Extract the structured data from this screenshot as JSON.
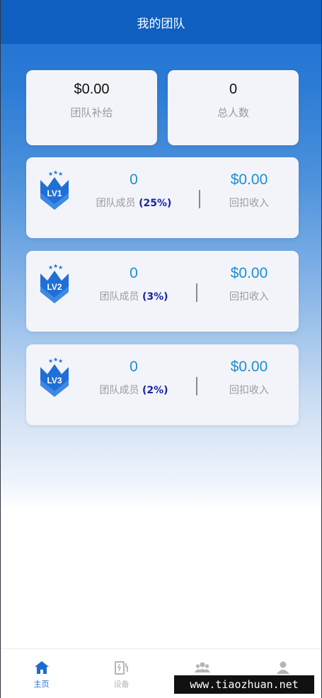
{
  "header": {
    "title": "我的团队"
  },
  "stats": [
    {
      "value": "$0.00",
      "label": "团队补给"
    },
    {
      "value": "0",
      "label": "总人数"
    }
  ],
  "levels": [
    {
      "badge": "LV1",
      "members": "0",
      "members_label": "团队成员",
      "percent": "(25%)",
      "income": "$0.00",
      "income_label": "回扣收入"
    },
    {
      "badge": "LV2",
      "members": "0",
      "members_label": "团队成员",
      "percent": "(3%)",
      "income": "$0.00",
      "income_label": "回扣收入"
    },
    {
      "badge": "LV3",
      "members": "0",
      "members_label": "团队成员",
      "percent": "(2%)",
      "income": "$0.00",
      "income_label": "回扣收入"
    }
  ],
  "tabbar": {
    "items": [
      {
        "label": "主页",
        "icon": "home-icon",
        "active": true
      },
      {
        "label": "设备",
        "icon": "device-icon",
        "active": false
      },
      {
        "label": "",
        "icon": "team-icon",
        "active": false
      },
      {
        "label": "",
        "icon": "user-icon",
        "active": false
      }
    ]
  },
  "watermark": "www.tiaozhuan.net",
  "colors": {
    "header": "#0f5fc0",
    "accent_value": "#1c8fd0",
    "percent": "#1a23a8",
    "tab_active": "#1b6ccf"
  }
}
